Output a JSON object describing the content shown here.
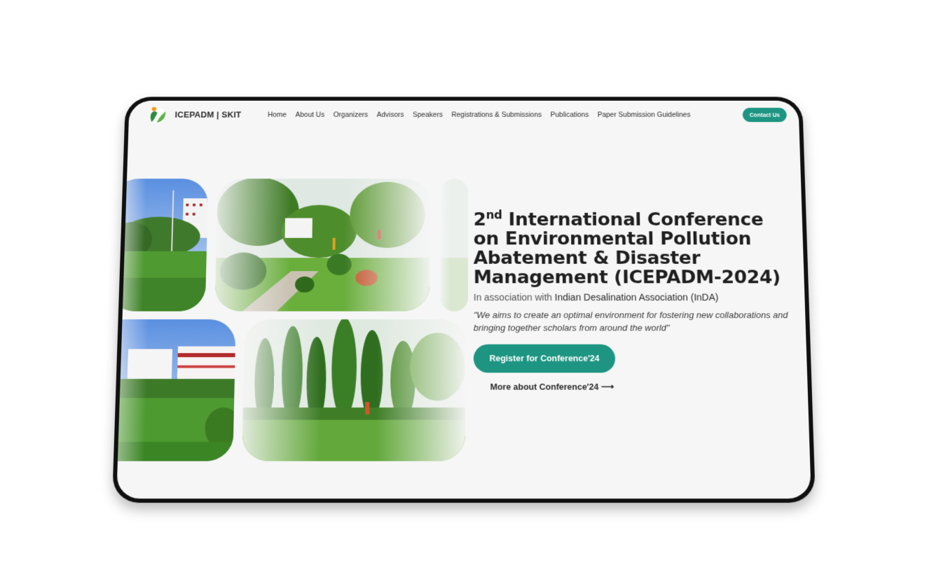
{
  "brand": {
    "name": "ICEPADM | SKIT",
    "logo_icon": "leaf-logo-icon"
  },
  "nav": {
    "items": [
      {
        "label": "Home"
      },
      {
        "label": "About Us"
      },
      {
        "label": "Organizers"
      },
      {
        "label": "Advisors"
      },
      {
        "label": "Speakers"
      },
      {
        "label": "Registrations & Submissions"
      },
      {
        "label": "Publications"
      },
      {
        "label": "Paper Submission Guidelines"
      }
    ],
    "contact_label": "Contact Us"
  },
  "hero": {
    "title_ordinal": "2",
    "title_suffix": "nd",
    "title_rest": " International Conference on Environmental Pollution Abatement & Disaster Management (ICEPADM-2024)",
    "assoc_prefix": "In association with ",
    "assoc_name": "Indian Desalination Association (InDA)",
    "quote": "\"We aims to create an optimal environment for fostering new collaborations and bringing together scholars from around the world\"",
    "register_label": "Register for Conference'24",
    "more_label": "More about Conference'24 ⟶"
  },
  "colors": {
    "accent": "#1d9582",
    "background": "#f6f6f6",
    "frame": "#101010"
  }
}
